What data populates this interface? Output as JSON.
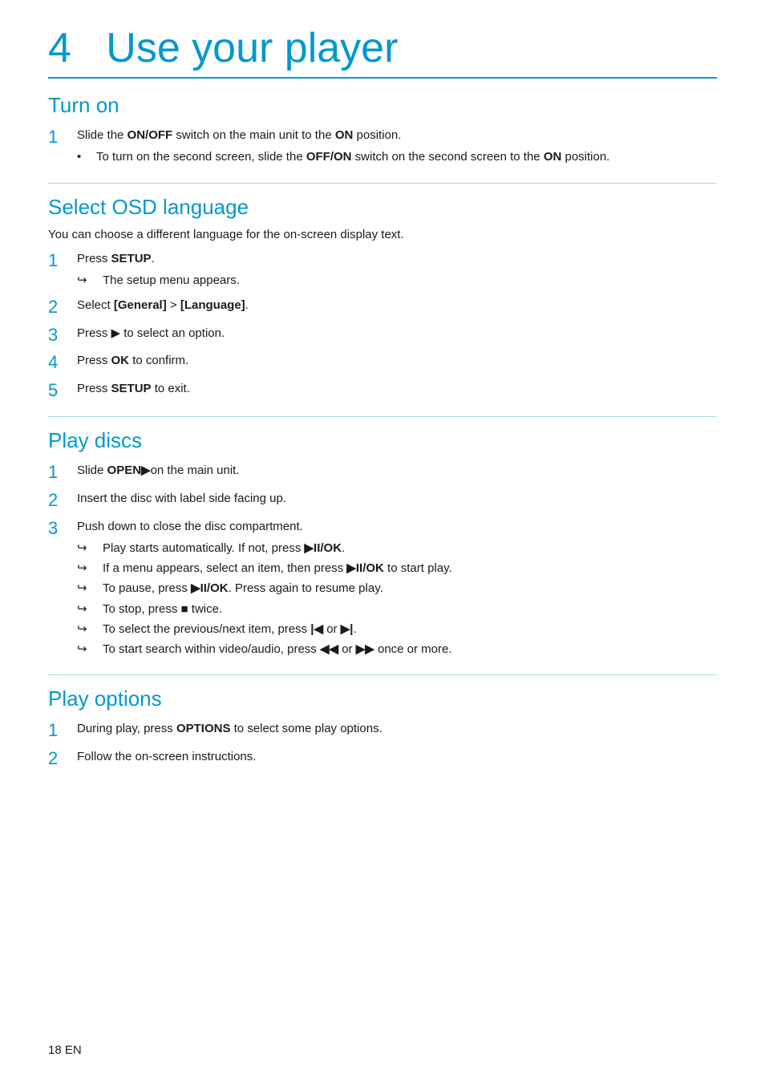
{
  "page": {
    "chapter": "4",
    "title": "Use your player",
    "footer": "18    EN"
  },
  "sections": {
    "turn_on": {
      "title": "Turn on",
      "steps": [
        {
          "num": "1",
          "text": "Slide the <b>ON/OFF</b> switch on the main unit to the <b>ON</b> position.",
          "sub": [
            "To turn on the second screen, slide the <b>OFF/ON</b> switch on the second screen to the <b>ON</b> position."
          ],
          "sub_type": "dot"
        }
      ]
    },
    "select_osd": {
      "title": "Select OSD language",
      "intro": "You can choose a different language for the on-screen display text.",
      "steps": [
        {
          "num": "1",
          "text": "Press <b>SETUP</b>.",
          "sub": [
            "The setup menu appears."
          ],
          "sub_type": "arrow"
        },
        {
          "num": "2",
          "text": "Select <b>[General]</b> &gt; <b>[Language]</b>.",
          "sub": [],
          "sub_type": "none"
        },
        {
          "num": "3",
          "text": "Press ▶ to select an option.",
          "sub": [],
          "sub_type": "none"
        },
        {
          "num": "4",
          "text": "Press <b>OK</b> to confirm.",
          "sub": [],
          "sub_type": "none"
        },
        {
          "num": "5",
          "text": "Press <b>SETUP</b> to exit.",
          "sub": [],
          "sub_type": "none"
        }
      ]
    },
    "play_discs": {
      "title": "Play discs",
      "steps": [
        {
          "num": "1",
          "text": "Slide <b>OPEN▶</b>on the main unit.",
          "sub": [],
          "sub_type": "none"
        },
        {
          "num": "2",
          "text": "Insert the disc with label side facing up.",
          "sub": [],
          "sub_type": "none"
        },
        {
          "num": "3",
          "text": "Push down to close the disc compartment.",
          "sub": [
            "Play starts automatically. If not, press <b>▶II/OK</b>.",
            "If a menu appears, select an item, then press <b>▶II/OK</b> to start play.",
            "To pause, press <b>▶II/OK</b>. Press again to resume play.",
            "To stop, press <b>■</b> twice.",
            "To select the previous/next item, press <b>|◀</b> or <b>▶|</b>.",
            "To start search within video/audio, press <b>◀◀</b> or <b>▶▶</b> once or more."
          ],
          "sub_type": "arrow"
        }
      ]
    },
    "play_options": {
      "title": "Play options",
      "steps": [
        {
          "num": "1",
          "text": "During play, press <b>OPTIONS</b> to select some play options.",
          "sub": [],
          "sub_type": "none"
        },
        {
          "num": "2",
          "text": "Follow the on-screen instructions.",
          "sub": [],
          "sub_type": "none"
        }
      ]
    }
  }
}
